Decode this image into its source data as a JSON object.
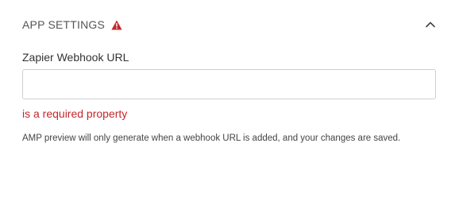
{
  "section": {
    "title": "APP SETTINGS",
    "warning_icon": "warning-triangle-icon",
    "toggle_icon": "chevron-up-icon"
  },
  "field": {
    "label": "Zapier Webhook URL",
    "value": "",
    "placeholder": "",
    "error": "is a required property"
  },
  "help_text": "AMP preview will only generate when a webhook URL is added, and your changes are saved.",
  "colors": {
    "error": "#c4272b",
    "warning_icon": "#c4272b",
    "border": "#cfcfcf"
  }
}
